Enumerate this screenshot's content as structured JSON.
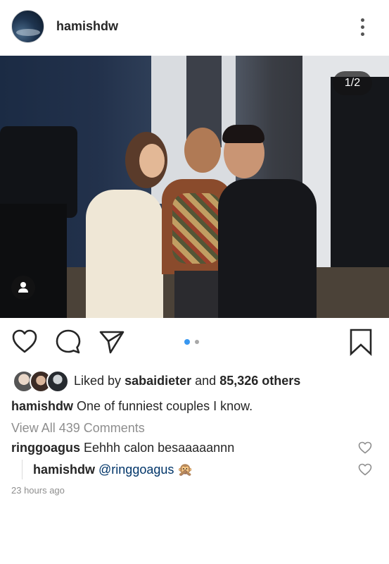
{
  "header": {
    "username": "hamishdw",
    "avatar_icon": "avatar",
    "more_icon": "more-vertical-icon"
  },
  "post": {
    "image_counter": "1/2",
    "current_slide": 1,
    "total_slides": 2,
    "tag_icon": "user-tag-icon"
  },
  "actions": {
    "like_icon": "heart-icon",
    "comment_icon": "comment-icon",
    "share_icon": "send-icon",
    "save_icon": "bookmark-icon",
    "dot_active_color": "#3897f0",
    "dot_inactive_color": "#a8a8a8"
  },
  "likes": {
    "prefix": "Liked by",
    "user": "sabaidieter",
    "and": "and",
    "count": "85,326 others"
  },
  "caption": {
    "username": "hamishdw",
    "text": "One of funniest couples I know."
  },
  "view_all": "View All 439 Comments",
  "comments": [
    {
      "username": "ringgoagus",
      "text": "Eehhh calon besaaaaannn"
    },
    {
      "username": "hamishdw",
      "mention": "@ringgoagus",
      "emoji": "🙊"
    }
  ],
  "timestamp": "23 hours ago"
}
